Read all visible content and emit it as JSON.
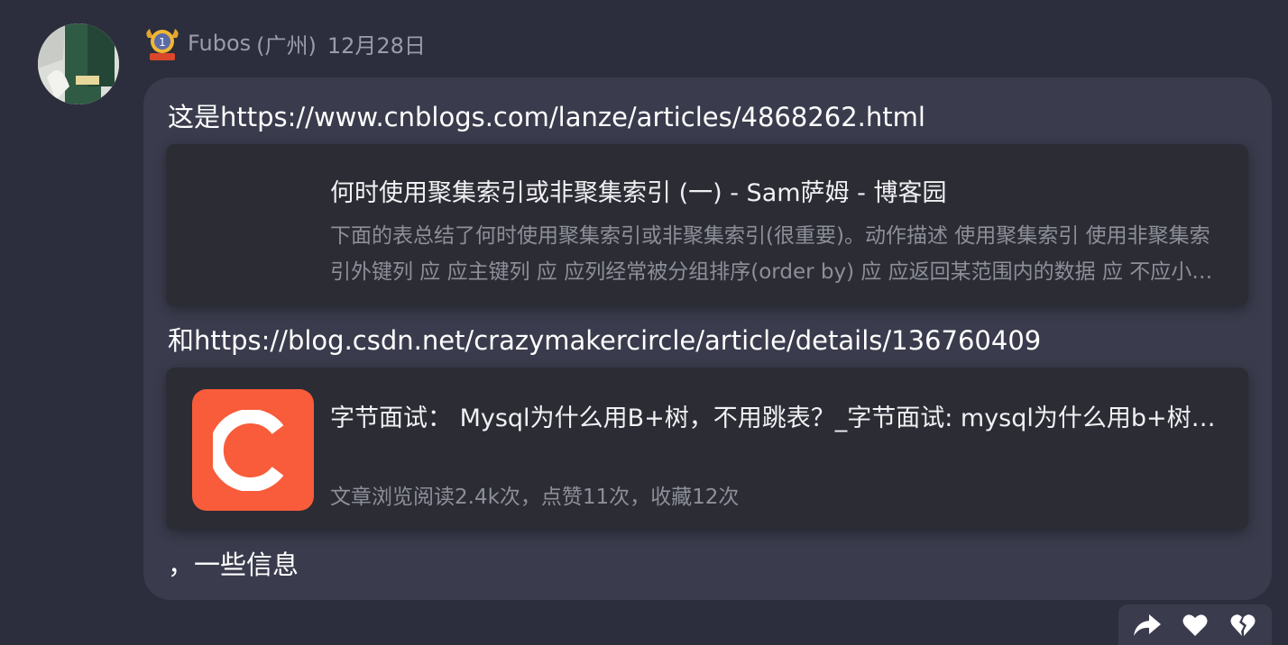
{
  "post": {
    "author": "Fubos",
    "location": "(广州)",
    "date": "12月28日",
    "line1": "这是https://www.cnblogs.com/lanze/articles/4868262.html",
    "line2": "和https://blog.csdn.net/crazymakercircle/article/details/136760409",
    "line3": "，一些信息"
  },
  "cards": [
    {
      "title": "何时使用聚集索引或非聚集索引 (一) - Sam萨姆 - 博客园",
      "description": "下面的表总结了何时使用聚集索引或非聚集索引(很重要)。动作描述 使用聚集索引 使用非聚集索引外键列 应 应主键列 应 应列经常被分组排序(order by) 应 应返回某范围内的数据 应 不应小数目的不同值 应 不应大数目的不同值 不应 应频繁更新的列 不应 应"
    },
    {
      "title": "字节面试： Mysql为什么用B+树，不用跳表？_字节面试: mysql为什么用b+树, 不用跳表?",
      "stats": "文章浏览阅读2.4k次，点赞11次，收藏12次"
    }
  ],
  "icons": {
    "medal": "medal-icon",
    "csdn_logo": "csdn-logo-icon",
    "share": "share-icon",
    "like": "heart-icon",
    "dislike": "broken-heart-icon"
  },
  "colors": {
    "background": "#2c2e3d",
    "bubble": "#3a3c4d",
    "card": "#2b2c34",
    "csdn_brand": "#f85c3a"
  }
}
